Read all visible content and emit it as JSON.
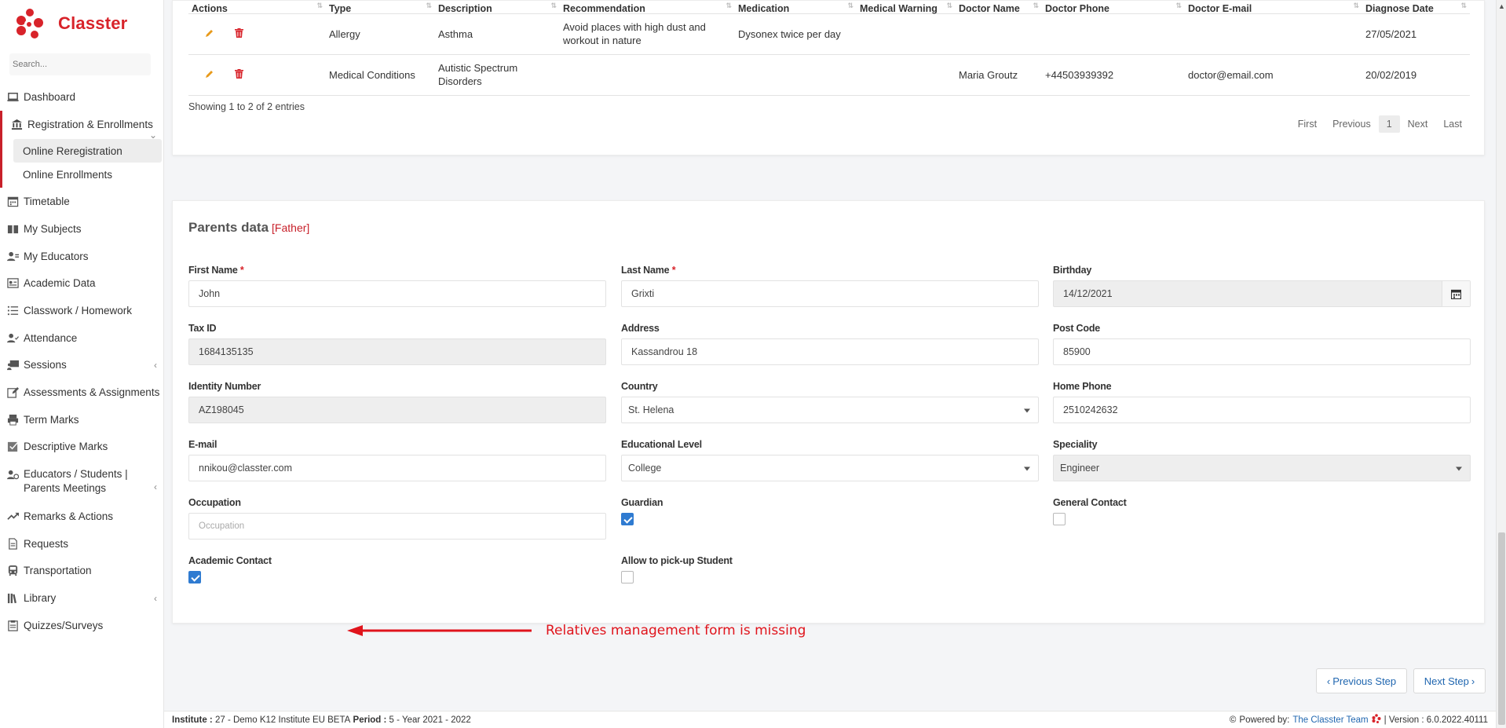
{
  "brand": {
    "name": "Classter",
    "color": "#d8232a"
  },
  "search": {
    "placeholder": "Search..."
  },
  "sidebar": {
    "items": [
      {
        "label": "Dashboard",
        "icon": "laptop-icon"
      },
      {
        "label": "Registration & Enrollments",
        "icon": "institution-icon"
      },
      {
        "label": "Timetable",
        "icon": "calendar-icon"
      },
      {
        "label": "My Subjects",
        "icon": "book-icon"
      },
      {
        "label": "My Educators",
        "icon": "users-icon"
      },
      {
        "label": "Academic Data",
        "icon": "id-card-icon"
      },
      {
        "label": "Classwork / Homework",
        "icon": "list-icon"
      },
      {
        "label": "Attendance",
        "icon": "user-check-icon"
      },
      {
        "label": "Sessions",
        "icon": "presentation-icon"
      },
      {
        "label": "Assessments & Assignments",
        "icon": "edit-icon"
      },
      {
        "label": "Term Marks",
        "icon": "printer-icon"
      },
      {
        "label": "Descriptive Marks",
        "icon": "check-square-icon"
      },
      {
        "label": "Educators / Students | Parents Meetings",
        "icon": "meeting-icon"
      },
      {
        "label": "Remarks & Actions",
        "icon": "shuffle-icon"
      },
      {
        "label": "Requests",
        "icon": "document-icon"
      },
      {
        "label": "Transportation",
        "icon": "bus-icon"
      },
      {
        "label": "Library",
        "icon": "library-icon"
      },
      {
        "label": "Quizzes/Surveys",
        "icon": "clipboard-icon"
      }
    ],
    "sub_items": [
      {
        "label": "Online Reregistration"
      },
      {
        "label": "Online Enrollments"
      }
    ]
  },
  "table": {
    "headers": [
      "Actions",
      "Type",
      "Description",
      "Recommendation",
      "Medication",
      "Medical Warning",
      "Doctor Name",
      "Doctor Phone",
      "Doctor E-mail",
      "Diagnose Date"
    ],
    "rows": [
      [
        "",
        "Allergy",
        "Asthma",
        "Avoid places with high dust and workout in nature",
        "Dysonex twice per day",
        "",
        "",
        "",
        "",
        "27/05/2021"
      ],
      [
        "",
        "Medical Conditions",
        "Autistic Spectrum Disorders",
        "",
        "",
        "",
        "Maria Groutz",
        "+44503939392",
        "doctor@email.com",
        "20/02/2019"
      ]
    ],
    "showing": "Showing 1 to 2 of 2 entries",
    "pager": {
      "first": "First",
      "previous": "Previous",
      "current": "1",
      "next": "Next",
      "last": "Last"
    }
  },
  "form": {
    "title": "Parents data",
    "relation": "[Father]",
    "fields": {
      "first_name": {
        "label": "First Name",
        "value": "John"
      },
      "last_name": {
        "label": "Last Name",
        "value": "Grixti"
      },
      "birthday": {
        "label": "Birthday",
        "value": "14/12/2021"
      },
      "tax_id": {
        "label": "Tax ID",
        "value": "1684135135"
      },
      "address": {
        "label": "Address",
        "value": "Kassandrou 18"
      },
      "post_code": {
        "label": "Post Code",
        "value": "85900"
      },
      "identity_number": {
        "label": "Identity Number",
        "value": "AZ198045"
      },
      "country": {
        "label": "Country",
        "value": "St. Helena"
      },
      "home_phone": {
        "label": "Home Phone",
        "value": "2510242632"
      },
      "email": {
        "label": "E-mail",
        "value": "nnikou@classter.com"
      },
      "educational_level": {
        "label": "Educational Level",
        "value": "College"
      },
      "speciality": {
        "label": "Speciality",
        "value": "Engineer"
      },
      "occupation": {
        "label": "Occupation",
        "placeholder": "Occupation"
      },
      "guardian": {
        "label": "Guardian",
        "checked": true
      },
      "general_contact": {
        "label": "General Contact",
        "checked": false
      },
      "academic_contact": {
        "label": "Academic Contact",
        "checked": true
      },
      "allow_pickup": {
        "label": "Allow to pick-up Student",
        "checked": false
      }
    },
    "required_mark": "*"
  },
  "annotation": {
    "text": "Relatives management form is missing",
    "color": "#e0141c"
  },
  "buttons": {
    "previous_step": "Previous Step",
    "next_step": "Next Step"
  },
  "footer": {
    "institute_label": "Institute :",
    "institute_value": "27 - Demo K12 Institute EU BETA",
    "period_label": "Period :",
    "period_value": "5 - Year 2021 - 2022",
    "powered_by": "Powered by:",
    "team": "The Classter Team",
    "version": "| Version : 6.0.2022.40111"
  }
}
